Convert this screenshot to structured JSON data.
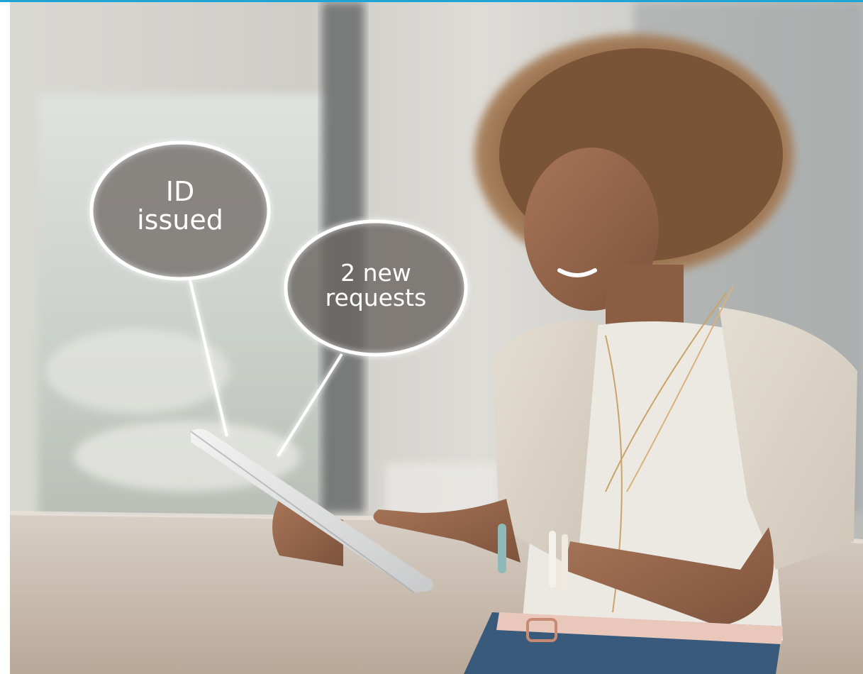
{
  "colors": {
    "top_accent": "#1fa4d6",
    "callout_stroke": "#ffffff",
    "callout_fill": "#6e6a66"
  },
  "callouts": [
    {
      "line1": "ID",
      "line2": "issued"
    },
    {
      "line1": "2 new",
      "line2": "requests"
    }
  ]
}
